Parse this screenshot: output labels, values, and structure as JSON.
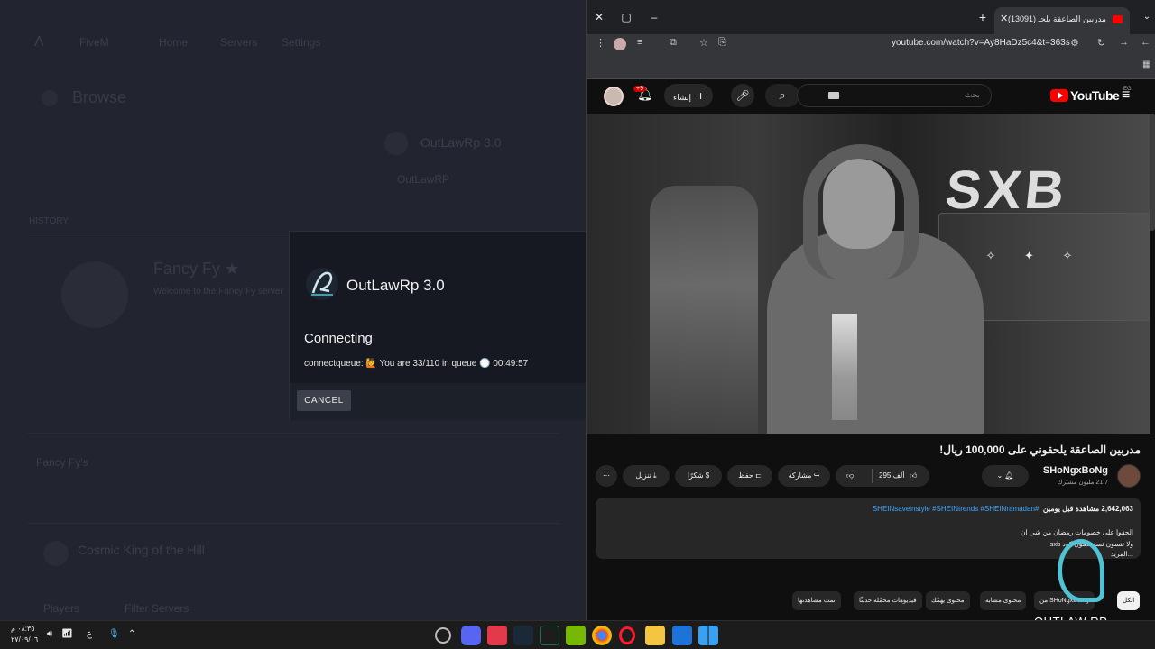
{
  "launcher": {
    "brand": "FiveM",
    "nav": [
      "Home",
      "Servers",
      "Settings"
    ],
    "section_title": "Browse",
    "featured_server": "OutLawRp 3.0",
    "featured_sub": "OutLawRP",
    "history_label": "HISTORY",
    "server1": "Fancy Fy ★",
    "server1_sub": "Welcome to the Fancy Fy server",
    "server2": "Fancy Fy's",
    "server3": "Cosmic King of the Hill",
    "footer_left": "Players",
    "footer_right": "Filter Servers"
  },
  "dialog": {
    "title": "OutLawRp 3.0",
    "status": "Connecting",
    "queue_text": "connectqueue: 🙋 You are 33/110 in queue 🕐 00:49:57",
    "cancel_label": "CANCEL"
  },
  "browser": {
    "tab_title": "(13091) مدربين الصاعقة يلحـ",
    "url": "youtube.com/watch?v=Ay8HaDz5c4&t=363s"
  },
  "youtube": {
    "logo_text": "YouTube",
    "region": "EG",
    "search_placeholder": "بحث",
    "create_label": "إنشاء",
    "notif_badge": "+9",
    "video_title": "مدربين الصاعقة يلحقوني على 100,000 ريال!",
    "channel_name": "SHoNgxBoNg",
    "channel_subs": "21.7 مليون مشترك",
    "likes": "295 ألف",
    "share_label": "مشاركة",
    "save_label": "حفظ",
    "thanks_label": "شكرًا",
    "download_label": "تنزيل",
    "desc_stats": "2,642,063 مشاهدة قبل يومين",
    "desc_tags": "#SHEINsaveinstyle #SHEINtrends #SHEINramadan",
    "desc_line2": "الحقوا على خصومات رمضان من شي ان",
    "desc_line3": "ولا تنسون تستخدمون كود sxb",
    "desc_more": "...المزيد",
    "chips": [
      "الكل",
      "من SHoNgxBoNg",
      "محتوى مشابه",
      "محتوى يهمّك",
      "فيديوهات محمّلة حديثًا",
      "تمت مشاهدتها"
    ],
    "watermark": "OUTLAW RP"
  },
  "taskbar": {
    "time": "٠٨:٣٥ م",
    "date": "٢٧/٠٩/٠٦",
    "lang": "ع"
  }
}
